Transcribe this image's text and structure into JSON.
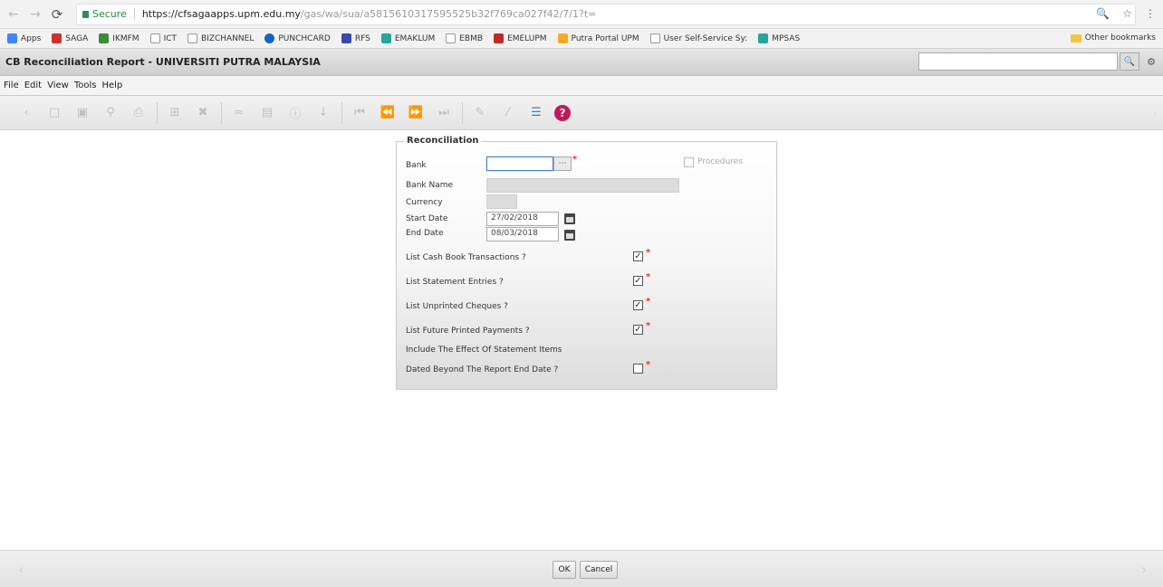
{
  "browser": {
    "secure_label": "Secure",
    "url_host": "https://cfsagaapps.upm.edu.my",
    "url_path": "/gas/wa/sua/a5815610317595525b32f769ca027f42/7/1?t=",
    "bookmarks": [
      {
        "label": "Apps",
        "color": "#4285f4"
      },
      {
        "label": "SAGA",
        "color": "#d32f2f"
      },
      {
        "label": "IKMFM",
        "color": "#388e3c"
      },
      {
        "label": "ICT",
        "color": "#9e9e9e"
      },
      {
        "label": "BIZCHANNEL",
        "color": "#9e9e9e"
      },
      {
        "label": "PUNCHCARD",
        "color": "#1565c0"
      },
      {
        "label": "RFS",
        "color": "#3949ab"
      },
      {
        "label": "EMAKLUM",
        "color": "#26a69a"
      },
      {
        "label": "EBMB",
        "color": "#9e9e9e"
      },
      {
        "label": "EMELUPM",
        "color": "#c62828"
      },
      {
        "label": "Putra Portal UPM",
        "color": "#f9a825"
      },
      {
        "label": "User Self-Service Sy:",
        "color": "#9e9e9e"
      },
      {
        "label": "MPSAS",
        "color": "#26a69a"
      }
    ],
    "other_bookmarks": "Other bookmarks"
  },
  "app": {
    "title": "CB Reconciliation Report - UNIVERSITI PUTRA MALAYSIA",
    "menu": [
      "File",
      "Edit",
      "View",
      "Tools",
      "Help"
    ]
  },
  "form": {
    "legend": "Reconciliation",
    "bank_label": "Bank",
    "bank_value": "",
    "bank_name_label": "Bank Name",
    "currency_label": "Currency",
    "start_date_label": "Start Date",
    "start_date_value": "27/02/2018",
    "end_date_label": "End Date",
    "end_date_value": "08/03/2018",
    "procedures_label": "Procedures",
    "options": [
      {
        "label": "List Cash Book Transactions ?",
        "checked": "✓"
      },
      {
        "label": "List Statement Entries ?",
        "checked": "✓"
      },
      {
        "label": "List Unprinted Cheques ?",
        "checked": "✓"
      },
      {
        "label": "List Future Printed Payments ?",
        "checked": "✓"
      }
    ],
    "include_label": "Include The Effect Of Statement Items",
    "dated_label": "Dated Beyond The Report End Date ?",
    "dated_checked": ""
  },
  "buttons": {
    "ok": "OK",
    "cancel": "Cancel"
  }
}
